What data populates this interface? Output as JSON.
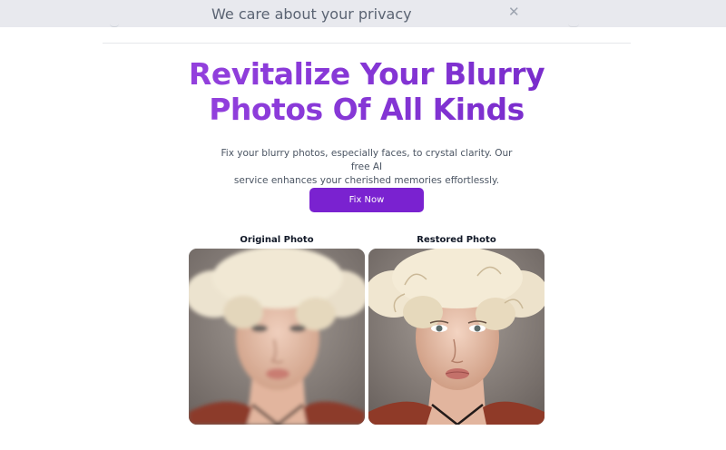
{
  "privacy_banner": {
    "title": "We care about your privacy",
    "close_icon": "close-icon"
  },
  "hero": {
    "headline_line1": "Revitalize Your Blurry",
    "headline_line2": "Photos Of All Kinds",
    "description_line1": "Fix your blurry photos, especially faces, to crystal clarity. Our free AI",
    "description_line2": "service enhances your cherished memories effortlessly.",
    "cta_label": "Fix Now"
  },
  "comparison": {
    "original_label": "Original Photo",
    "restored_label": "Restored Photo"
  },
  "colors": {
    "accent": "#7a22d0",
    "headline_start": "#a44de4",
    "headline_end": "#6d22c2",
    "banner_bg": "#e8e9ee"
  }
}
